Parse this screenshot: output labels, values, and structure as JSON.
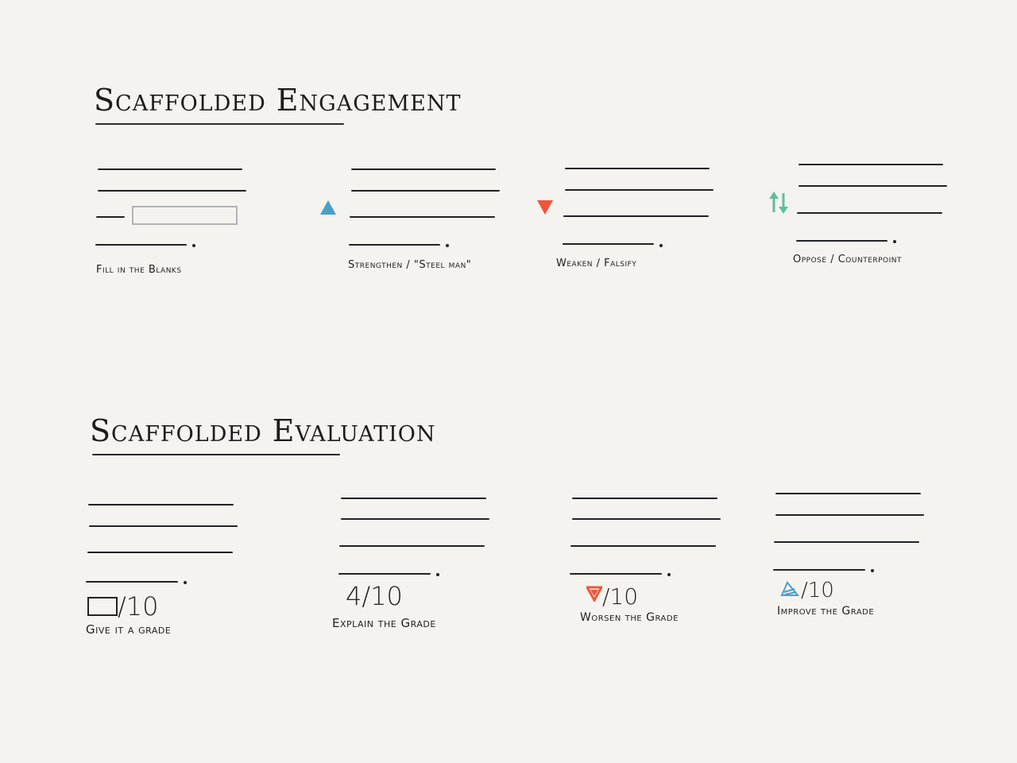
{
  "sections": {
    "engagement": {
      "title": "Scaffolded Engagement",
      "cards": [
        {
          "caption": "Fill in the Blanks"
        },
        {
          "caption": "Strengthen / \"Steel man\""
        },
        {
          "caption": "Weaken / Falsify"
        },
        {
          "caption": "Oppose / Counterpoint"
        }
      ]
    },
    "evaluation": {
      "title": "Scaffolded Evaluation",
      "cards": [
        {
          "caption": "Give it a grade",
          "grade": "/10"
        },
        {
          "caption": "Explain the Grade",
          "grade": "4/10"
        },
        {
          "caption": "Worsen the Grade",
          "grade": "/10"
        },
        {
          "caption": "Improve the Grade",
          "grade": "/10"
        }
      ]
    }
  },
  "colors": {
    "strengthen": "#4a9fc8",
    "weaken": "#f0553a",
    "oppose": "#5fbf9c",
    "improve": "#4a9fc8"
  },
  "icons": {
    "strengthen": "triangle-up-icon",
    "weaken": "triangle-down-icon",
    "oppose": "up-down-arrows-icon",
    "worsen": "triangle-down-icon",
    "improve": "pencil-icon"
  }
}
